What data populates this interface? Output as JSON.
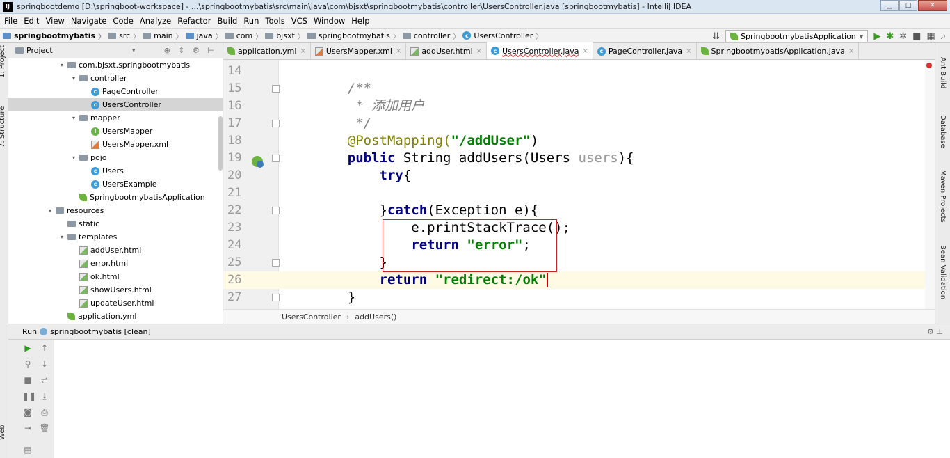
{
  "window": {
    "title": "springbootdemo [D:\\springboot-workspace] - ...\\springbootmybatis\\src\\main\\java\\com\\bjsxt\\springbootmybatis\\controller\\UsersController.java [springbootmybatis] - IntelliJ IDEA",
    "app_icon": "IJ",
    "minimize_glyph": "▁",
    "maximize_glyph": "□",
    "close_glyph": "✕"
  },
  "menu": [
    "File",
    "Edit",
    "View",
    "Navigate",
    "Code",
    "Analyze",
    "Refactor",
    "Build",
    "Run",
    "Tools",
    "VCS",
    "Window",
    "Help"
  ],
  "breadcrumbs": [
    "springbootmybatis",
    "src",
    "main",
    "java",
    "com",
    "bjsxt",
    "springbootmybatis",
    "controller",
    "UsersController"
  ],
  "run_config": {
    "label": "SpringbootmybatisApplication",
    "arrow": "▾"
  },
  "left_tools": [
    "1: Project",
    "7: Structure",
    "Web"
  ],
  "project_panel": {
    "title": "Project",
    "tree": [
      {
        "indent": 1,
        "arrow": "▾",
        "icon": "folder",
        "label": "com.bjsxt.springbootmybatis",
        "selected": false
      },
      {
        "indent": 2,
        "arrow": "▾",
        "icon": "folder",
        "label": "controller",
        "selected": false
      },
      {
        "indent": 3,
        "arrow": "",
        "icon": "class",
        "label": "PageController",
        "selected": false
      },
      {
        "indent": 3,
        "arrow": "",
        "icon": "class",
        "label": "UsersController",
        "selected": true
      },
      {
        "indent": 2,
        "arrow": "▾",
        "icon": "folder",
        "label": "mapper",
        "selected": false
      },
      {
        "indent": 3,
        "arrow": "",
        "icon": "interface",
        "label": "UsersMapper",
        "selected": false
      },
      {
        "indent": 3,
        "arrow": "",
        "icon": "xml",
        "label": "UsersMapper.xml",
        "selected": false
      },
      {
        "indent": 2,
        "arrow": "▾",
        "icon": "folder",
        "label": "pojo",
        "selected": false
      },
      {
        "indent": 3,
        "arrow": "",
        "icon": "class",
        "label": "Users",
        "selected": false
      },
      {
        "indent": 3,
        "arrow": "",
        "icon": "class",
        "label": "UsersExample",
        "selected": false
      },
      {
        "indent": 2,
        "arrow": "",
        "icon": "spring",
        "label": "SpringbootmybatisApplication",
        "selected": false
      },
      {
        "indent": 0,
        "arrow": "▾",
        "icon": "folder",
        "label": "resources",
        "selected": false
      },
      {
        "indent": 1,
        "arrow": "",
        "icon": "folder",
        "label": "static",
        "selected": false
      },
      {
        "indent": 1,
        "arrow": "▾",
        "icon": "folder",
        "label": "templates",
        "selected": false
      },
      {
        "indent": 2,
        "arrow": "",
        "icon": "html",
        "label": "addUser.html",
        "selected": false
      },
      {
        "indent": 2,
        "arrow": "",
        "icon": "html",
        "label": "error.html",
        "selected": false
      },
      {
        "indent": 2,
        "arrow": "",
        "icon": "html",
        "label": "ok.html",
        "selected": false
      },
      {
        "indent": 2,
        "arrow": "",
        "icon": "html",
        "label": "showUsers.html",
        "selected": false
      },
      {
        "indent": 2,
        "arrow": "",
        "icon": "html",
        "label": "updateUser.html",
        "selected": false
      },
      {
        "indent": 1,
        "arrow": "",
        "icon": "spring",
        "label": "application.yml",
        "selected": false
      }
    ]
  },
  "editor_tabs": [
    {
      "label": "application.yml",
      "icon": "spring",
      "active": false
    },
    {
      "label": "UsersMapper.xml",
      "icon": "xml",
      "active": false
    },
    {
      "label": "addUser.html",
      "icon": "html",
      "active": false
    },
    {
      "label": "UsersController.java",
      "icon": "class",
      "active": true
    },
    {
      "label": "PageController.java",
      "icon": "class",
      "active": false
    },
    {
      "label": "SpringbootmybatisApplication.java",
      "icon": "spring",
      "active": false
    }
  ],
  "code_lines": [
    {
      "num": "14",
      "tokens": []
    },
    {
      "num": "15",
      "tokens": [
        {
          "t": "    /**",
          "c": "cmt"
        }
      ]
    },
    {
      "num": "16",
      "tokens": [
        {
          "t": "     * 添加用户",
          "c": "cmt"
        }
      ]
    },
    {
      "num": "17",
      "tokens": [
        {
          "t": "     */",
          "c": "cmt"
        }
      ]
    },
    {
      "num": "18",
      "tokens": [
        {
          "t": "    @PostMapping(",
          "c": "ann"
        },
        {
          "t": "\"/addUser\"",
          "c": "str"
        },
        {
          "t": ")",
          "c": ""
        }
      ]
    },
    {
      "num": "19",
      "tokens": [
        {
          "t": "    ",
          "c": ""
        },
        {
          "t": "public",
          "c": "kw"
        },
        {
          "t": " String addUsers(Users ",
          "c": ""
        },
        {
          "t": "users",
          "c": "param"
        },
        {
          "t": "){",
          "c": ""
        }
      ]
    },
    {
      "num": "20",
      "tokens": [
        {
          "t": "        ",
          "c": ""
        },
        {
          "t": "try",
          "c": "kw"
        },
        {
          "t": "{",
          "c": ""
        }
      ]
    },
    {
      "num": "21",
      "tokens": []
    },
    {
      "num": "22",
      "tokens": [
        {
          "t": "        }",
          "c": ""
        },
        {
          "t": "catch",
          "c": "kw"
        },
        {
          "t": "(Exception e){",
          "c": ""
        }
      ]
    },
    {
      "num": "23",
      "tokens": [
        {
          "t": "            e.printStackTrace();",
          "c": ""
        }
      ]
    },
    {
      "num": "24",
      "tokens": [
        {
          "t": "            ",
          "c": ""
        },
        {
          "t": "return",
          "c": "kw"
        },
        {
          "t": " ",
          "c": ""
        },
        {
          "t": "\"error\"",
          "c": "str"
        },
        {
          "t": ";",
          "c": ""
        }
      ]
    },
    {
      "num": "25",
      "tokens": [
        {
          "t": "        }",
          "c": ""
        }
      ]
    },
    {
      "num": "26",
      "tokens": [
        {
          "t": "        ",
          "c": ""
        },
        {
          "t": "return",
          "c": "kw"
        },
        {
          "t": " ",
          "c": ""
        },
        {
          "t": "\"redirect:/ok\"",
          "c": "str"
        }
      ]
    },
    {
      "num": "27",
      "tokens": [
        {
          "t": "    }",
          "c": ""
        }
      ]
    }
  ],
  "editor_breadcrumb": [
    "UsersController",
    "addUsers()"
  ],
  "right_tools": [
    "Ant Build",
    "Database",
    "Maven Projects",
    "Bean Validation"
  ],
  "run_panel": {
    "prefix": "Run",
    "title": "springbootmybatis [clean]"
  },
  "colors": {
    "accent": "#3d9bd6",
    "keyword": "#000080",
    "string": "#008000",
    "highlight_box": "#d02020"
  }
}
